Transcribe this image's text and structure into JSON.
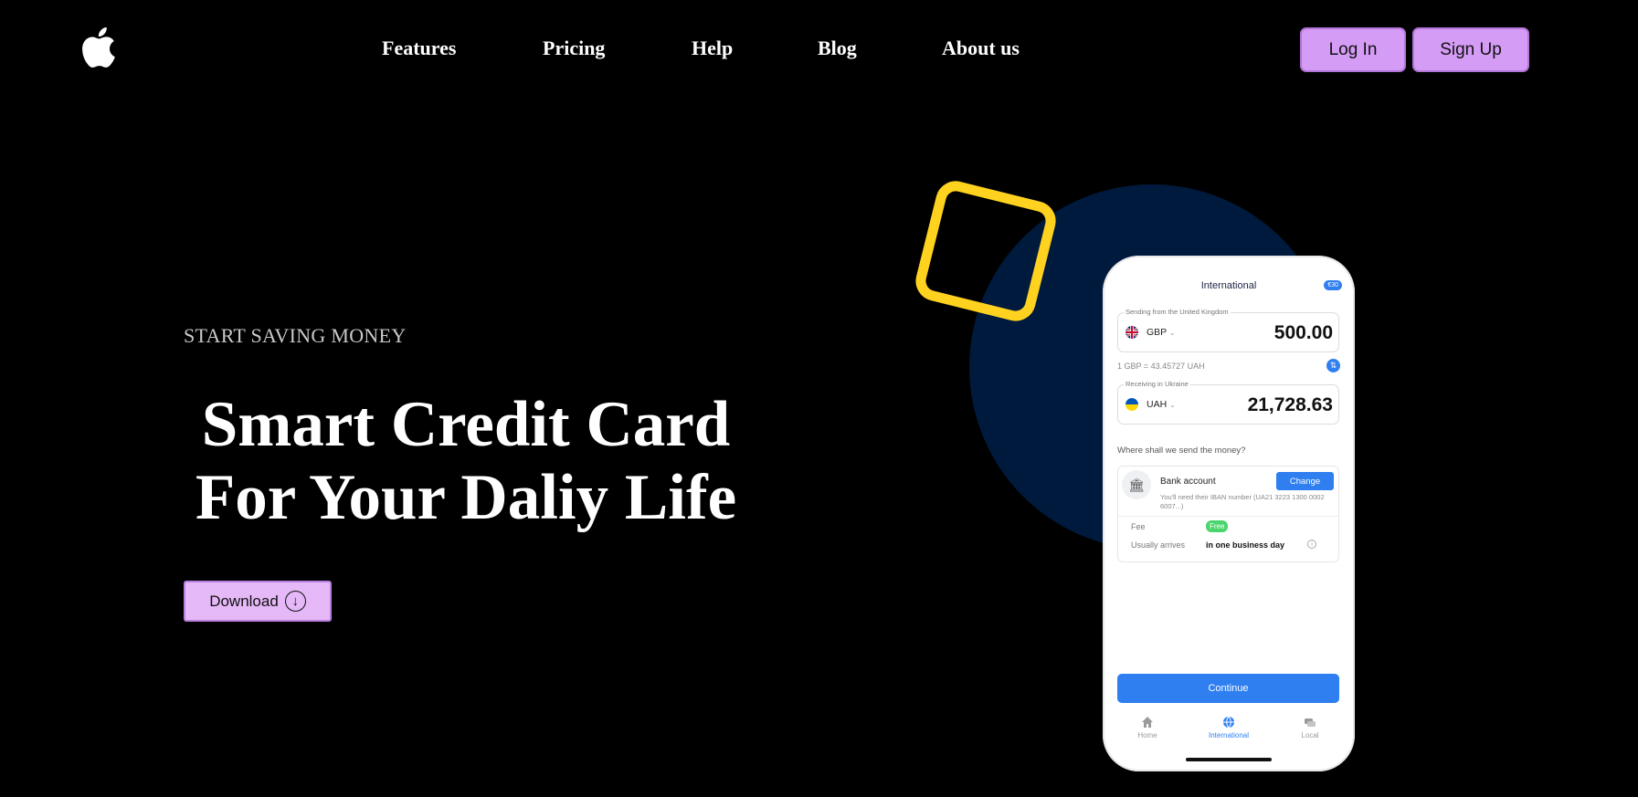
{
  "nav": {
    "links": [
      "Features",
      "Pricing",
      "Help",
      "Blog",
      "About us"
    ],
    "login_label": "Log In",
    "signup_label": "Sign Up"
  },
  "hero": {
    "eyebrow": "START SAVING MONEY",
    "headline_line1": "Smart Credit Card",
    "headline_line2": "For Your Daliy Life",
    "download_label": "Download",
    "download_icon": "arrow-down-circle-icon"
  },
  "phone": {
    "title": "International",
    "badge": "€30",
    "sending_label": "Sending from the United Kingdom",
    "sending_currency": "GBP",
    "sending_amount": "500.00",
    "rate": "1 GBP = 43.45727 UAH",
    "receiving_label": "Receiving in Ukraine",
    "receiving_currency": "UAH",
    "receiving_amount": "21,728.63",
    "where_label": "Where shall we send the money?",
    "bank_name": "Bank account",
    "change_label": "Change",
    "bank_note": "You'll need their IBAN number (UA21 3223 1300 0002 6007...)",
    "fee_label": "Fee",
    "fee_value": "Free",
    "arrives_label": "Usually arrives",
    "arrives_value": "in one business day",
    "continue_label": "Continue",
    "tabs": [
      "Home",
      "International",
      "Local"
    ],
    "active_tab": "International"
  },
  "colors": {
    "background": "#000000",
    "button": "#d59cf6",
    "download_button": "#e5b8f7",
    "accent_yellow": "#ffd21f",
    "circle_navy": "#001a3d",
    "phone_blue": "#2f7ff0"
  }
}
